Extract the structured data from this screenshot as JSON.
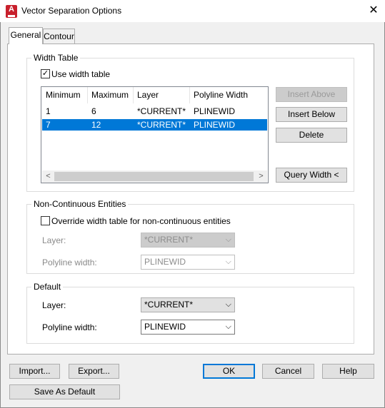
{
  "window": {
    "title": "Vector Separation Options",
    "close_glyph": "✕",
    "icon_letter": "A"
  },
  "tabs": [
    {
      "label": "General",
      "active": true
    },
    {
      "label": "Contour",
      "active": false
    }
  ],
  "width_table": {
    "group_label": "Width Table",
    "use_width_table": {
      "label": "Use width table",
      "checked": true,
      "glyph": "✓"
    },
    "columns": [
      "Minimum",
      "Maximum",
      "Layer",
      "Polyline Width"
    ],
    "rows": [
      {
        "minimum": "1",
        "maximum": "6",
        "layer": "*CURRENT*",
        "polyline_width": "PLINEWID",
        "selected": false
      },
      {
        "minimum": "7",
        "maximum": "12",
        "layer": "*CURRENT*",
        "polyline_width": "PLINEWID",
        "selected": true
      }
    ],
    "scroll_left": "<",
    "scroll_right": ">",
    "buttons": {
      "insert_above": "Insert Above",
      "insert_below": "Insert Below",
      "delete": "Delete",
      "query_width": "Query Width <"
    }
  },
  "non_continuous": {
    "group_label": "Non-Continuous Entities",
    "override": {
      "label": "Override width table for non-continuous entities",
      "checked": false
    },
    "layer_label": "Layer:",
    "layer_value": "*CURRENT*",
    "polyline_label": "Polyline width:",
    "polyline_value": "PLINEWID"
  },
  "default": {
    "group_label": "Default",
    "layer_label": "Layer:",
    "layer_value": "*CURRENT*",
    "polyline_label": "Polyline width:",
    "polyline_value": "PLINEWID"
  },
  "footer": {
    "import": "Import...",
    "export": "Export...",
    "ok": "OK",
    "cancel": "Cancel",
    "help": "Help",
    "save_default": "Save As Default"
  },
  "chevron_glyph": "⌵",
  "colors": {
    "accent": "#0078d7",
    "app_icon": "#c8202c",
    "dialog_bg": "#f0f0f0"
  }
}
